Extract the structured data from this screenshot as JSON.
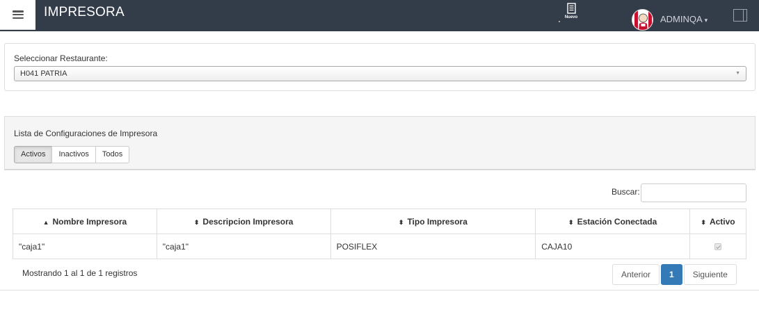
{
  "header": {
    "title": "IMPRESORA",
    "nuevo_label": "Nuevo",
    "user_name": "ADMINQA",
    "menu_icon": "hamburger-icon",
    "nuevo_icon": "document-icon",
    "panel_icon": "sidebar-toggle-icon"
  },
  "restaurant": {
    "label": "Seleccionar Restaurante:",
    "selected": "H041 PATRIA"
  },
  "config": {
    "title": "Lista de Configuraciones de Impresora",
    "filters": [
      "Activos",
      "Inactivos",
      "Todos"
    ],
    "active_filter": "Activos"
  },
  "table": {
    "search_label": "Buscar:",
    "search_value": "",
    "columns": [
      "Nombre Impresora",
      "Descripcion Impresora",
      "Tipo Impresora",
      "Estación Conectada",
      "Activo"
    ],
    "rows": [
      {
        "nombre": "\"caja1\"",
        "descripcion": "\"caja1\"",
        "tipo": "POSIFLEX",
        "estacion": "CAJA10",
        "activo": true
      }
    ],
    "info": "Mostrando 1 al 1 de 1 registros",
    "pagination": {
      "prev": "Anterior",
      "current": "1",
      "next": "Siguiente"
    }
  },
  "colors": {
    "topbar": "#333c49",
    "primary": "#337ab7"
  }
}
